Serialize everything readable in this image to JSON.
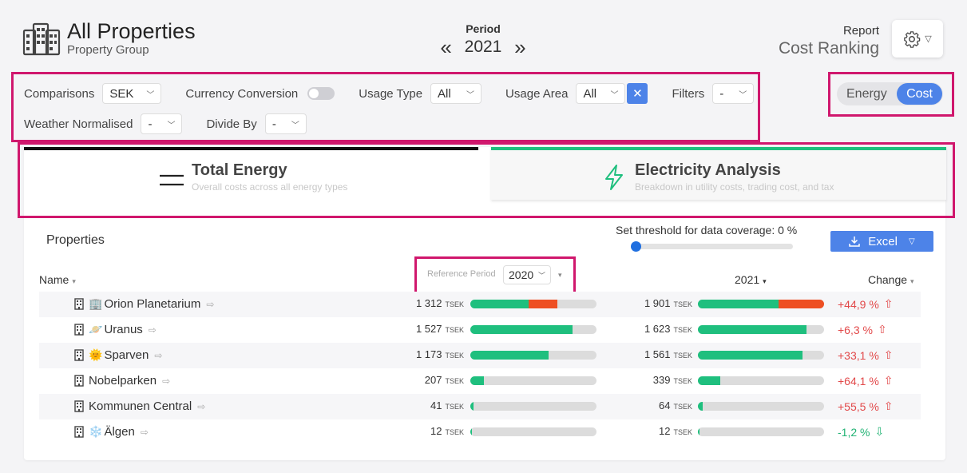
{
  "header": {
    "title": "All Properties",
    "subtitle": "Property Group",
    "building_icon": "building-icon"
  },
  "period": {
    "label": "Period",
    "year": "2021",
    "prev": "«",
    "next": "»"
  },
  "report": {
    "label": "Report",
    "value": "Cost Ranking",
    "gear_icon": "gear-icon"
  },
  "filters": {
    "comparisons": {
      "label": "Comparisons",
      "value": "SEK"
    },
    "currency_conversion": {
      "label": "Currency Conversion",
      "enabled": false
    },
    "usage_type": {
      "label": "Usage Type",
      "value": "All"
    },
    "usage_area": {
      "label": "Usage Area",
      "value": "All"
    },
    "filters": {
      "label": "Filters",
      "value": "-"
    },
    "weather_normalised": {
      "label": "Weather Normalised",
      "value": "-"
    },
    "divide_by": {
      "label": "Divide By",
      "value": "-"
    }
  },
  "mode_toggle": {
    "energy": "Energy",
    "cost": "Cost",
    "active": "Cost"
  },
  "tabs": [
    {
      "title": "Total Energy",
      "subtitle": "Overall costs across all energy types",
      "icon": "lines-icon",
      "accent": "#111111"
    },
    {
      "title": "Electricity Analysis",
      "subtitle": "Breakdown in utility costs, trading cost, and tax",
      "icon": "lightning-icon",
      "accent": "#1fbf7e"
    }
  ],
  "table": {
    "title": "Properties",
    "threshold_label": "Set threshold for data coverage: 0 %",
    "threshold_value": 0,
    "excel_label": "Excel",
    "columns": {
      "name": "Name",
      "reference_label": "Reference Period",
      "reference_year": "2020",
      "current_year": "2021",
      "change": "Change"
    },
    "unit": "TSEK",
    "rows": [
      {
        "name": "Orion Planetarium",
        "emoji": "🏢",
        "ref": "1 312",
        "ref_green": 0.46,
        "ref_orange": 0.23,
        "cur": "1 901",
        "cur_green": 0.64,
        "cur_orange": 0.36,
        "change": "+44,9 %",
        "dir": "up"
      },
      {
        "name": "Uranus",
        "emoji": "🪐",
        "ref": "1 527",
        "ref_green": 0.81,
        "ref_orange": 0,
        "cur": "1 623",
        "cur_green": 0.86,
        "cur_orange": 0,
        "change": "+6,3 %",
        "dir": "up"
      },
      {
        "name": "Sparven",
        "emoji": "🌞",
        "ref": "1 173",
        "ref_green": 0.62,
        "ref_orange": 0,
        "cur": "1 561",
        "cur_green": 0.83,
        "cur_orange": 0,
        "change": "+33,1 %",
        "dir": "up"
      },
      {
        "name": "Nobelparken",
        "emoji": "",
        "ref": "207",
        "ref_green": 0.11,
        "ref_orange": 0,
        "cur": "339",
        "cur_green": 0.18,
        "cur_orange": 0,
        "change": "+64,1 %",
        "dir": "up"
      },
      {
        "name": "Kommunen Central",
        "emoji": "",
        "ref": "41",
        "ref_green": 0.025,
        "ref_orange": 0,
        "cur": "64",
        "cur_green": 0.035,
        "cur_orange": 0,
        "change": "+55,5 %",
        "dir": "up"
      },
      {
        "name": "Älgen",
        "emoji": "❄️",
        "ref": "12",
        "ref_green": 0.01,
        "ref_orange": 0,
        "cur": "12",
        "cur_green": 0.01,
        "cur_orange": 0,
        "change": "-1,2 %",
        "dir": "down"
      }
    ]
  },
  "colors": {
    "accent_blue": "#4d83e8",
    "highlight": "#d0176d",
    "green": "#1fbf7e",
    "orange": "#ee4f23",
    "up_red": "#e2494a",
    "down_green": "#22b374"
  }
}
